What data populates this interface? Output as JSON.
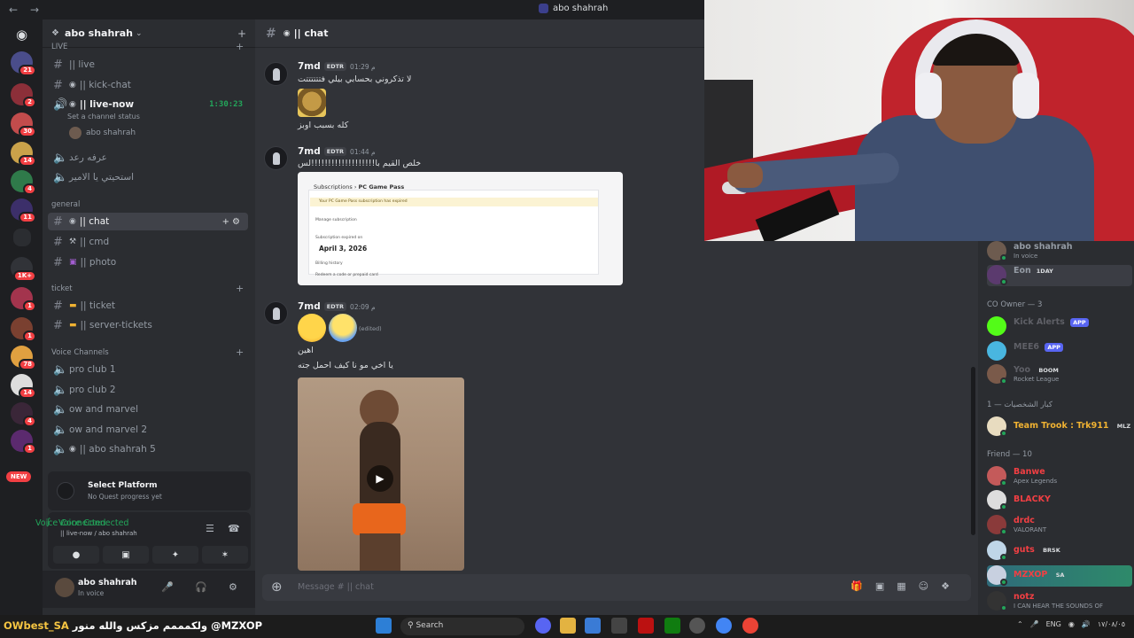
{
  "window": {
    "title": "abo shahrah",
    "back_icon": "arrow-left-icon",
    "forward_icon": "arrow-right-icon"
  },
  "rail": {
    "badges": [
      "21",
      "2",
      "30",
      "14",
      "4",
      "11",
      "1K+",
      "1",
      "1",
      "78",
      "14",
      "4",
      "1"
    ],
    "new_label": "NEW"
  },
  "sidebar": {
    "server_name": "abo shahrah",
    "categories": {
      "live": "LIVE",
      "general": "general",
      "ticket": "ticket",
      "voice": "Voice Channels"
    },
    "channels": {
      "live": "|| live",
      "kick_chat": "|| kick-chat",
      "live_now": "|| live-now",
      "live_now_timer": "1:30:23",
      "set_status": "Set a channel status",
      "voice_user": "abo shahrah",
      "arabic1": "عرفه رعد",
      "arabic2": "استحيتي يا الامير",
      "chat": "|| chat",
      "cmd": "|| cmd",
      "photo": "|| photo",
      "ticket": "|| ticket",
      "server_tickets": "|| server-tickets",
      "pro_club_1": "pro club 1",
      "pro_club_2": "pro club 2",
      "ow_marvel": "ow and marvel",
      "ow_marvel_2": "ow and marvel 2",
      "abo_shahrah_5": "|| abo shahrah 5"
    }
  },
  "quest": {
    "title": "Select Platform",
    "subtitle": "No Quest progress yet"
  },
  "voice_panel": {
    "status": "Voice Connected",
    "location": "|| live-now / abo shahrah"
  },
  "userbar": {
    "name": "abo shahrah",
    "status": "In voice"
  },
  "chat": {
    "channel_name": "|| chat",
    "messages": [
      {
        "author": "7md",
        "tag": "EDTR",
        "time": "01:29 م",
        "lines": [
          "لا تذكروني بحسابي بيلي فتتتتتتت",
          "كله بسبب اوبز"
        ]
      },
      {
        "author": "7md",
        "tag": "EDTR",
        "time": "01:44 م",
        "lines": [
          "خلص القيم با!!!!!!!!!!!!!!!!!!!لس"
        ]
      },
      {
        "author": "7md",
        "tag": "EDTR",
        "time": "02:09 م",
        "lines": [
          "اهين",
          "يا اخي مو نا كيف احمل جته"
        ],
        "edited": "(edited)"
      }
    ],
    "attachment": {
      "breadcrumb_root": "Subscriptions",
      "breadcrumb_leaf": "PC Game Pass",
      "banner": "Your PC Game Pass subscription has expired",
      "manage": "Manage subscription",
      "expired_label": "Subscription expired on",
      "date": "April 3, 2026",
      "billing": "Billing history",
      "redeem": "Redeem a code or prepaid card"
    },
    "composer_placeholder": "Message # || chat"
  },
  "members": {
    "top": [
      {
        "name": "abo shahrah",
        "status": "In voice",
        "color": "#949ba4"
      },
      {
        "name": "Eon",
        "badge": "1DAY",
        "status": "",
        "color": "#949ba4"
      }
    ],
    "groups": [
      {
        "label": "CO Owner — 3",
        "items": [
          {
            "name": "Kick Alerts",
            "badge": "APP",
            "color": "#5f6067"
          },
          {
            "name": "MEE6",
            "badge": "APP",
            "color": "#5f6067"
          },
          {
            "name": "Yoo",
            "badge": "BOOM",
            "status": "Rocket League",
            "color": "#5f6067"
          }
        ]
      },
      {
        "label": "كبار الشخصيات — 1",
        "items": [
          {
            "name": "Team Trook : Trk911",
            "badge": "MLZ",
            "color": "#f0b232"
          }
        ]
      },
      {
        "label": "Friend — 10",
        "items": [
          {
            "name": "Banwe",
            "status": "Apex Legends",
            "color": "#f23f43"
          },
          {
            "name": "BLACKY",
            "color": "#f23f43"
          },
          {
            "name": "drdc",
            "status": "VALORANT",
            "color": "#f23f43"
          },
          {
            "name": "guts",
            "badge": "BRSK",
            "color": "#f23f43"
          },
          {
            "name": "MZXOP",
            "badge": "SA",
            "color": "#f23f43"
          },
          {
            "name": "notz",
            "status": "I CAN HEAR THE SOUNDS OF",
            "color": "#f23f43"
          }
        ]
      }
    ]
  },
  "taskbar": {
    "ticker_name": "OWbest_SA",
    "ticker_text": "ولكمممم مزكس والله منور",
    "ticker_handle": "@MZXOP",
    "search": "Search",
    "lang": "ENG",
    "clock": "١٧/٠٨/٠٥"
  },
  "colors": {
    "accent": "#5865f2",
    "online": "#23a55a",
    "danger": "#f23f43"
  }
}
